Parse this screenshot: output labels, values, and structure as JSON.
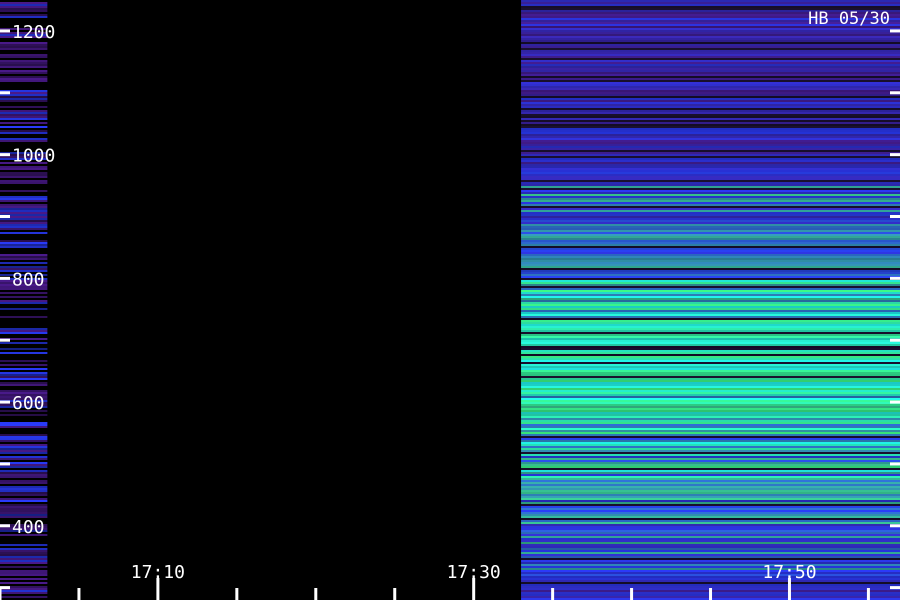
{
  "chart_data": {
    "type": "heatmap",
    "title": "",
    "station_label": "HB 05/30",
    "xlabel": "",
    "ylabel": "",
    "x_axis": {
      "labeled_ticks": [
        "17:10",
        "17:30",
        "17:50"
      ],
      "label_interval_minutes": 20,
      "minor_tick_interval_minutes": 5
    },
    "y_axis": {
      "tick_labels": [
        "400",
        "600",
        "800",
        "1000",
        "1200"
      ],
      "tick_values": [
        400,
        600,
        800,
        1000,
        1200
      ],
      "minor_tick_interval": 100,
      "ylim": [
        280,
        1250
      ]
    },
    "time_range": [
      "17:00",
      "17:57"
    ],
    "segments": [
      {
        "name": "",
        "start": "17:00",
        "end": "17:03",
        "level": "low"
      },
      {
        "name": "",
        "start": "17:03",
        "end": "17:33",
        "level": "none"
      },
      {
        "name": "",
        "start": "17:33",
        "end": "17:57",
        "level": "high"
      }
    ],
    "band_structure": "horizontal lines, constant across time",
    "colors": {
      "background": "#000000",
      "low": "#4a1a8c",
      "mid": "#2a3cff",
      "high": "#40ff80",
      "peak": "#20ffff",
      "axis": "#ffffff"
    },
    "grid": false,
    "legend": "none"
  }
}
